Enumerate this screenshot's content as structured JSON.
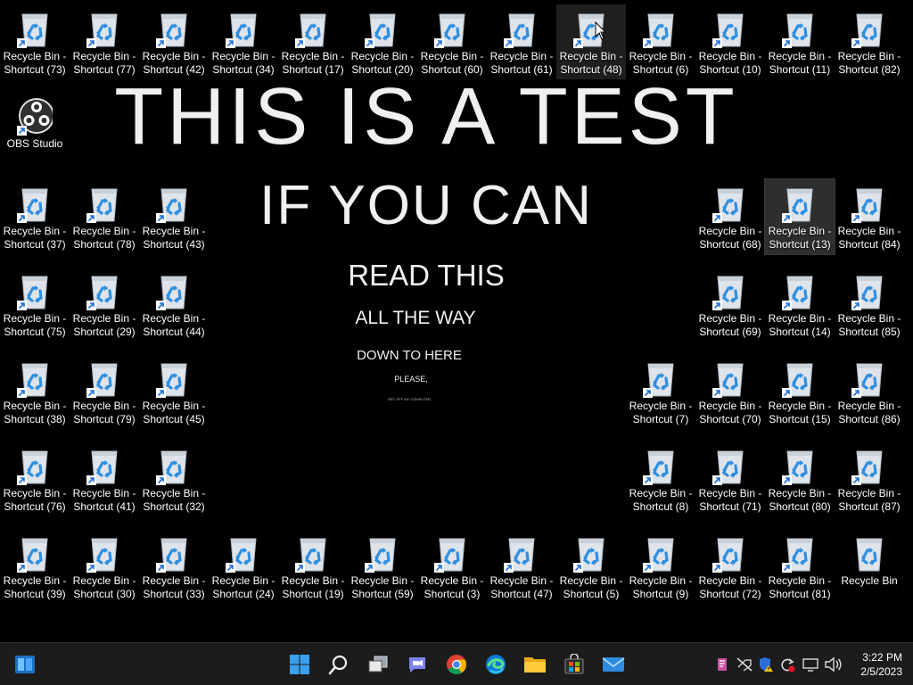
{
  "wallpaper": {
    "lines": [
      "THIS IS A TEST",
      "IF YOU CAN",
      "READ THIS",
      "ALL THE WAY",
      "DOWN TO HERE",
      "PLEASE,",
      "GET OFF MY COMPUTER"
    ]
  },
  "desktop_icons": [
    {
      "label": "Recycle Bin - Shortcut (73)",
      "col": 0,
      "row": 0
    },
    {
      "label": "Recycle Bin - Shortcut (77)",
      "col": 1,
      "row": 0
    },
    {
      "label": "Recycle Bin - Shortcut (42)",
      "col": 2,
      "row": 0
    },
    {
      "label": "Recycle Bin - Shortcut (34)",
      "col": 3,
      "row": 0
    },
    {
      "label": "Recycle Bin - Shortcut (17)",
      "col": 4,
      "row": 0
    },
    {
      "label": "Recycle Bin - Shortcut (20)",
      "col": 5,
      "row": 0
    },
    {
      "label": "Recycle Bin - Shortcut (60)",
      "col": 6,
      "row": 0
    },
    {
      "label": "Recycle Bin - Shortcut (61)",
      "col": 7,
      "row": 0
    },
    {
      "label": "Recycle Bin - Shortcut (48)",
      "col": 8,
      "row": 0,
      "state": "hovered"
    },
    {
      "label": "Recycle Bin - Shortcut (6)",
      "col": 9,
      "row": 0
    },
    {
      "label": "Recycle Bin - Shortcut (10)",
      "col": 10,
      "row": 0
    },
    {
      "label": "Recycle Bin - Shortcut (11)",
      "col": 11,
      "row": 0
    },
    {
      "label": "Recycle Bin - Shortcut (82)",
      "col": 12,
      "row": 0
    },
    {
      "label": "OBS Studio",
      "col": 0,
      "row": 1,
      "icon": "obs"
    },
    {
      "label": "Recycle Bin - Shortcut (37)",
      "col": 0,
      "row": 2
    },
    {
      "label": "Recycle Bin - Shortcut (78)",
      "col": 1,
      "row": 2
    },
    {
      "label": "Recycle Bin - Shortcut (43)",
      "col": 2,
      "row": 2
    },
    {
      "label": "Recycle Bin - Shortcut (68)",
      "col": 10,
      "row": 2
    },
    {
      "label": "Recycle Bin - Shortcut (13)",
      "col": 11,
      "row": 2,
      "state": "selected"
    },
    {
      "label": "Recycle Bin - Shortcut (84)",
      "col": 12,
      "row": 2
    },
    {
      "label": "Recycle Bin - Shortcut (75)",
      "col": 0,
      "row": 3
    },
    {
      "label": "Recycle Bin - Shortcut (29)",
      "col": 1,
      "row": 3
    },
    {
      "label": "Recycle Bin - Shortcut (44)",
      "col": 2,
      "row": 3
    },
    {
      "label": "Recycle Bin - Shortcut (69)",
      "col": 10,
      "row": 3
    },
    {
      "label": "Recycle Bin - Shortcut (14)",
      "col": 11,
      "row": 3
    },
    {
      "label": "Recycle Bin - Shortcut (85)",
      "col": 12,
      "row": 3
    },
    {
      "label": "Recycle Bin - Shortcut (38)",
      "col": 0,
      "row": 4
    },
    {
      "label": "Recycle Bin - Shortcut (79)",
      "col": 1,
      "row": 4
    },
    {
      "label": "Recycle Bin - Shortcut (45)",
      "col": 2,
      "row": 4
    },
    {
      "label": "Recycle Bin - Shortcut (7)",
      "col": 9,
      "row": 4
    },
    {
      "label": "Recycle Bin - Shortcut (70)",
      "col": 10,
      "row": 4
    },
    {
      "label": "Recycle Bin - Shortcut (15)",
      "col": 11,
      "row": 4
    },
    {
      "label": "Recycle Bin - Shortcut (86)",
      "col": 12,
      "row": 4
    },
    {
      "label": "Recycle Bin - Shortcut (76)",
      "col": 0,
      "row": 5
    },
    {
      "label": "Recycle Bin - Shortcut (41)",
      "col": 1,
      "row": 5
    },
    {
      "label": "Recycle Bin - Shortcut (32)",
      "col": 2,
      "row": 5
    },
    {
      "label": "Recycle Bin - Shortcut (8)",
      "col": 9,
      "row": 5
    },
    {
      "label": "Recycle Bin - Shortcut (71)",
      "col": 10,
      "row": 5
    },
    {
      "label": "Recycle Bin - Shortcut (80)",
      "col": 11,
      "row": 5
    },
    {
      "label": "Recycle Bin - Shortcut (87)",
      "col": 12,
      "row": 5
    },
    {
      "label": "Recycle Bin - Shortcut (39)",
      "col": 0,
      "row": 6
    },
    {
      "label": "Recycle Bin - Shortcut (30)",
      "col": 1,
      "row": 6
    },
    {
      "label": "Recycle Bin - Shortcut (33)",
      "col": 2,
      "row": 6
    },
    {
      "label": "Recycle Bin - Shortcut (24)",
      "col": 3,
      "row": 6
    },
    {
      "label": "Recycle Bin - Shortcut (19)",
      "col": 4,
      "row": 6
    },
    {
      "label": "Recycle Bin - Shortcut (59)",
      "col": 5,
      "row": 6
    },
    {
      "label": "Recycle Bin - Shortcut (3)",
      "col": 6,
      "row": 6
    },
    {
      "label": "Recycle Bin - Shortcut (47)",
      "col": 7,
      "row": 6
    },
    {
      "label": "Recycle Bin - Shortcut (5)",
      "col": 8,
      "row": 6
    },
    {
      "label": "Recycle Bin - Shortcut (9)",
      "col": 9,
      "row": 6
    },
    {
      "label": "Recycle Bin - Shortcut (72)",
      "col": 10,
      "row": 6
    },
    {
      "label": "Recycle Bin - Shortcut (81)",
      "col": 11,
      "row": 6
    },
    {
      "label": "Recycle Bin",
      "col": 12,
      "row": 6,
      "shortcut": false
    }
  ],
  "taskbar": {
    "pinned": [
      "start-icon",
      "search-icon",
      "task-view-icon",
      "teams-chat-icon",
      "chrome-icon",
      "edge-icon",
      "file-explorer-icon",
      "microsoft-store-icon",
      "mail-icon"
    ],
    "tray": [
      "onenote-icon",
      "network-disconnected-icon",
      "security-warning-icon",
      "sync-icon",
      "display-icon",
      "volume-icon"
    ],
    "time": "3:22 PM",
    "date": "2/5/2023"
  },
  "colors": {
    "taskbar_bg": "#1c1c1c",
    "recycle_blue": "#2f8fe0",
    "start_blue": "#3aa0f0"
  }
}
